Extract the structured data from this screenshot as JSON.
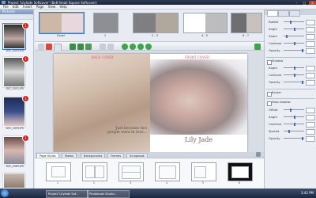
{
  "window": {
    "title": "Project 'Lilylade Softcover' (8x8 Small Square Softcover)"
  },
  "menu": [
    "File",
    "Edit",
    "Insert",
    "Page",
    "View",
    "Help"
  ],
  "pictures_panel": {
    "title": "Pictures",
    "items": [
      {
        "caption": "DSC_0445.JPG",
        "badge": "1"
      },
      {
        "caption": "DSC_0451.JPG",
        "badge": "1"
      },
      {
        "caption": "DSC_0459.JPG",
        "badge": "1"
      },
      {
        "caption": "DSC_0465.JPG",
        "badge": "1"
      },
      {
        "caption": "",
        "badge": ""
      }
    ]
  },
  "page_strip": [
    {
      "label": "Cover"
    },
    {
      "label": "1"
    },
    {
      "label": "2 - 3"
    },
    {
      "label": "4 - 5"
    },
    {
      "label": "6 - 7"
    }
  ],
  "canvas": {
    "back_cover_label": "BACK COVER",
    "front_cover_label": "FRONT COVER",
    "quote": "Just because two people were in love...",
    "baby_name": "Lily Jade"
  },
  "layout_tabs": [
    {
      "label": "Page Styles",
      "active": true
    },
    {
      "label": "Masks",
      "active": false
    },
    {
      "label": "Backgrounds",
      "active": false
    },
    {
      "label": "Frames",
      "active": false
    },
    {
      "label": "Scrapbook",
      "active": false
    }
  ],
  "layout_thumbs": [
    "1",
    "2",
    "3",
    "4",
    "5",
    "6"
  ],
  "properties": {
    "rows": [
      "Rotate",
      "Angle",
      "Zoom",
      "Contrast",
      "Opacity",
      "Angle",
      "Contrast",
      "Opacity",
      "Offset",
      "Angle",
      "Contrast",
      "Spread",
      "Opacity"
    ],
    "checkboxes": [
      "Shadow",
      "Border",
      "Drop shadow"
    ]
  },
  "taskbar": {
    "tasks": [
      "Project 'Lilylade Sof...",
      "Photobook Studio..."
    ],
    "clock": "3:42 PM"
  },
  "colors": {
    "accent": "#3a7bd5",
    "cover_label": "#e0507a",
    "badge": "#d81e1e"
  }
}
